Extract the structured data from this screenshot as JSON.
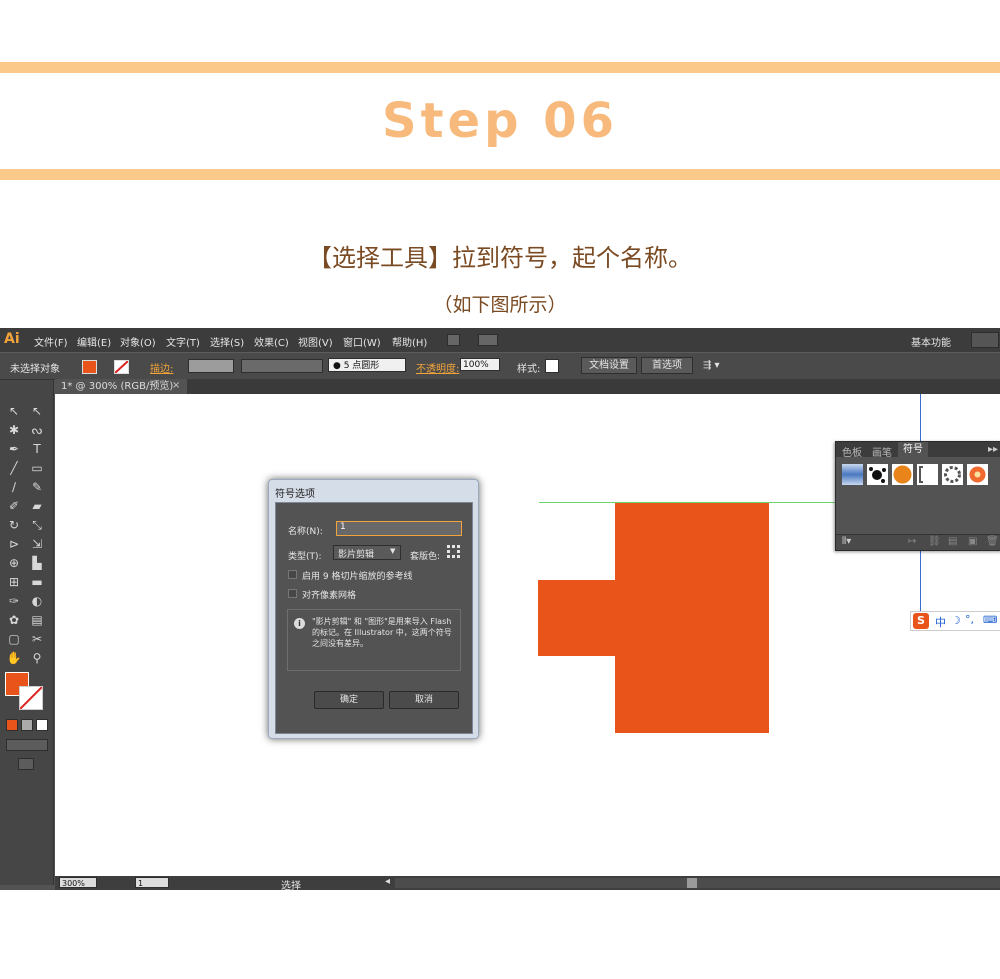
{
  "header": {
    "step_title": "Step 06",
    "instruction": "【选择工具】拉到符号，起个名称。",
    "note": "（如下图所示）"
  },
  "colors": {
    "accent_bar": "#fbc98a",
    "step_text": "#f7b97c",
    "shape_fill": "#e8541a",
    "ui_dark": "#535353"
  },
  "app": {
    "logo": "Ai",
    "menu": [
      "文件(F)",
      "编辑(E)",
      "对象(O)",
      "文字(T)",
      "选择(S)",
      "效果(C)",
      "视图(V)",
      "窗口(W)",
      "帮助(H)"
    ],
    "workspace": "基本功能",
    "control_bar": {
      "selection": "未选择对象",
      "stroke_label": "描边:",
      "point_style": "● 5 点圆形",
      "opacity_label": "不透明度:",
      "opacity_value": "100%",
      "style_label": "样式:",
      "doc_setup": "文档设置",
      "preferences": "首选项"
    },
    "doc_tab": "1* @ 300% (RGB/预览)",
    "status": {
      "zoom": "300%",
      "page": "1",
      "mode": "选择"
    },
    "tool_icons": [
      "selection-icon",
      "direct-selection-icon",
      "magic-wand-icon",
      "lasso-icon",
      "pen-icon",
      "type-icon",
      "line-icon",
      "rectangle-icon",
      "brush-icon",
      "pencil-icon",
      "blob-brush-icon",
      "eraser-icon",
      "rotate-icon",
      "scale-icon",
      "width-icon",
      "free-transform-icon",
      "shape-builder-icon",
      "perspective-icon",
      "mesh-icon",
      "gradient-icon",
      "eyedropper-icon",
      "blend-icon",
      "symbol-sprayer-icon",
      "graph-icon",
      "artboard-icon",
      "slice-icon",
      "hand-icon",
      "zoom-icon"
    ]
  },
  "dialog": {
    "title": "符号选项",
    "name_label": "名称(N):",
    "name_value": "1",
    "type_label": "类型(T):",
    "type_value": "影片剪辑",
    "registration_label": "套版色:",
    "checkbox_9slice": "启用 9 格切片缩放的参考线",
    "checkbox_pixel": "对齐像素网格",
    "info_text": "\"影片剪辑\" 和 \"图形\"是用来导入 Flash 的标记。在 Illustrator 中，这两个符号之间没有差异。",
    "ok": "确定",
    "cancel": "取消"
  },
  "panel": {
    "tabs": [
      "色板",
      "画笔",
      "符号"
    ],
    "active_tab": "符号"
  },
  "ime": {
    "label": "中"
  }
}
